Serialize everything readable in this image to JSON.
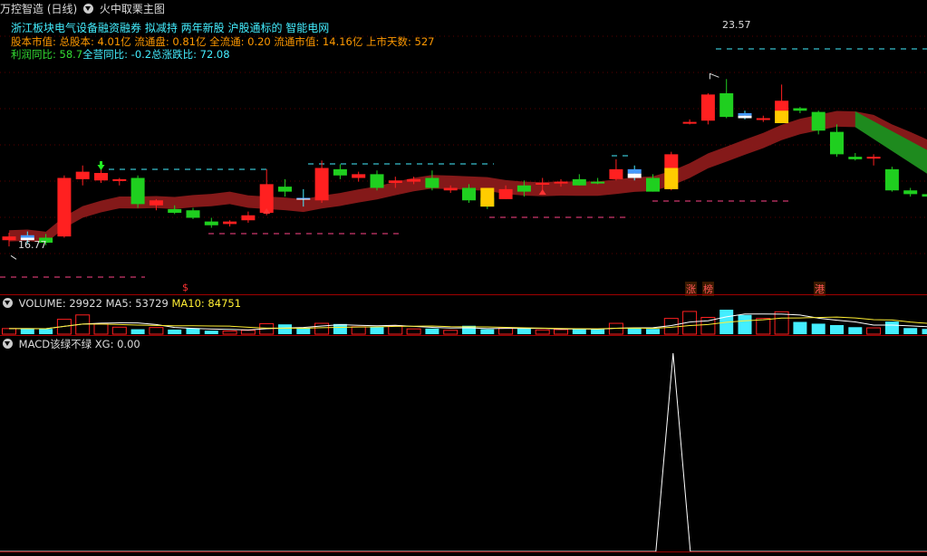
{
  "header": {
    "stock_title": "万控智造 (日线)",
    "main_indicator": "火中取栗主图"
  },
  "info": {
    "line1": "浙江板块电气设备融资融券 拟减持 两年新股 沪股通标的 智能电网",
    "line2": "股本市值: 总股本: 4.01亿 流通盘: 0.81亿 全流通: 0.20 流通市值: 14.16亿 上市天数: 527",
    "line3_a": "利润同比: 58.7",
    "line3_b": "全营同比: -0.2",
    "line3_c": "总涨跌比: 72.08"
  },
  "price_labels": {
    "high": "23.57",
    "low": "16.77"
  },
  "badges": {
    "s": "$",
    "zhang": "涨",
    "bang": "榜",
    "gang": "港"
  },
  "volume_panel": {
    "title": "VOLUME: 29922",
    "ma5": "MA5: 53729",
    "ma10": "MA10: 84751"
  },
  "macd_panel": {
    "title": "MACD该绿不绿",
    "xg": "XG: 0.00"
  },
  "colors": {
    "up": "#ff2020",
    "down": "#22cc22",
    "cyan": "#44eeff",
    "ma_band": "#8b1a1a",
    "ma_band_green": "#1e8a1e",
    "separator": "#a00000"
  },
  "chart_data": {
    "type": "candlestick",
    "price_range": [
      16.2,
      24.2
    ],
    "candles": [
      {
        "o": 17.1,
        "h": 17.4,
        "l": 16.85,
        "c": 17.25,
        "col": "red"
      },
      {
        "o": 17.1,
        "h": 17.45,
        "l": 16.95,
        "c": 17.3,
        "col": "cyan"
      },
      {
        "o": 17.2,
        "h": 17.35,
        "l": 16.9,
        "c": 17.0,
        "col": "green"
      },
      {
        "o": 17.25,
        "h": 19.7,
        "l": 17.2,
        "c": 19.6,
        "col": "red"
      },
      {
        "o": 19.55,
        "h": 20.1,
        "l": 19.3,
        "c": 19.85,
        "col": "red"
      },
      {
        "o": 19.8,
        "h": 20.0,
        "l": 19.4,
        "c": 19.5,
        "col": "red"
      },
      {
        "o": 19.5,
        "h": 19.6,
        "l": 19.3,
        "c": 19.55,
        "col": "red"
      },
      {
        "o": 19.6,
        "h": 19.7,
        "l": 18.4,
        "c": 18.55,
        "col": "green"
      },
      {
        "o": 18.5,
        "h": 18.75,
        "l": 18.3,
        "c": 18.7,
        "col": "red"
      },
      {
        "o": 18.35,
        "h": 18.5,
        "l": 18.15,
        "c": 18.2,
        "col": "green"
      },
      {
        "o": 18.3,
        "h": 18.4,
        "l": 17.95,
        "c": 18.0,
        "col": "green"
      },
      {
        "o": 17.85,
        "h": 18.0,
        "l": 17.6,
        "c": 17.7,
        "col": "green"
      },
      {
        "o": 17.75,
        "h": 17.9,
        "l": 17.65,
        "c": 17.85,
        "col": "red"
      },
      {
        "o": 17.9,
        "h": 18.25,
        "l": 17.8,
        "c": 18.1,
        "col": "red"
      },
      {
        "o": 18.2,
        "h": 19.95,
        "l": 18.1,
        "c": 19.35,
        "col": "red"
      },
      {
        "o": 19.25,
        "h": 19.55,
        "l": 18.85,
        "c": 19.05,
        "col": "green"
      },
      {
        "o": 18.75,
        "h": 19.15,
        "l": 18.45,
        "c": 18.8,
        "col": "cyan"
      },
      {
        "o": 18.7,
        "h": 20.3,
        "l": 18.6,
        "c": 20.0,
        "col": "red"
      },
      {
        "o": 19.95,
        "h": 20.15,
        "l": 19.55,
        "c": 19.7,
        "col": "green"
      },
      {
        "o": 19.75,
        "h": 19.85,
        "l": 19.45,
        "c": 19.6,
        "col": "red"
      },
      {
        "o": 19.75,
        "h": 19.9,
        "l": 19.1,
        "c": 19.2,
        "col": "green"
      },
      {
        "o": 19.5,
        "h": 19.65,
        "l": 19.2,
        "c": 19.4,
        "col": "red"
      },
      {
        "o": 19.55,
        "h": 19.65,
        "l": 19.35,
        "c": 19.45,
        "col": "red"
      },
      {
        "o": 19.6,
        "h": 19.9,
        "l": 19.1,
        "c": 19.2,
        "col": "green"
      },
      {
        "o": 19.2,
        "h": 19.3,
        "l": 19.0,
        "c": 19.1,
        "col": "red"
      },
      {
        "o": 19.2,
        "h": 19.35,
        "l": 18.6,
        "c": 18.7,
        "col": "green"
      },
      {
        "o": 18.8,
        "h": 18.95,
        "l": 18.35,
        "c": 18.45,
        "col": "green"
      },
      {
        "o": 19.15,
        "h": 19.3,
        "l": 18.75,
        "c": 18.75,
        "col": "red"
      },
      {
        "o": 19.3,
        "h": 19.5,
        "l": 18.85,
        "c": 19.05,
        "col": "green"
      },
      {
        "o": 19.4,
        "h": 19.6,
        "l": 19.1,
        "c": 19.35,
        "col": "red"
      },
      {
        "o": 19.4,
        "h": 19.55,
        "l": 19.25,
        "c": 19.45,
        "col": "red"
      },
      {
        "o": 19.55,
        "h": 19.75,
        "l": 19.3,
        "c": 19.3,
        "col": "green"
      },
      {
        "o": 19.45,
        "h": 19.6,
        "l": 19.35,
        "c": 19.45,
        "col": "green"
      },
      {
        "o": 19.55,
        "h": 20.35,
        "l": 19.5,
        "c": 19.95,
        "col": "red"
      },
      {
        "o": 19.6,
        "h": 20.1,
        "l": 19.5,
        "c": 19.95,
        "col": "cyan"
      },
      {
        "o": 19.6,
        "h": 19.75,
        "l": 19.05,
        "c": 19.05,
        "col": "green"
      },
      {
        "o": 19.15,
        "h": 20.65,
        "l": 19.1,
        "c": 20.55,
        "col": "red"
      },
      {
        "o": 21.8,
        "h": 21.95,
        "l": 21.75,
        "c": 21.85,
        "col": "red"
      },
      {
        "o": 21.9,
        "h": 23.0,
        "l": 21.75,
        "c": 22.95,
        "col": "red"
      },
      {
        "o": 23.0,
        "h": 23.57,
        "l": 22.0,
        "c": 22.05,
        "col": "green"
      },
      {
        "o": 22.0,
        "h": 22.3,
        "l": 21.95,
        "c": 22.2,
        "col": "cyan"
      },
      {
        "o": 22.0,
        "h": 22.1,
        "l": 21.85,
        "c": 21.95,
        "col": "red"
      },
      {
        "o": 21.95,
        "h": 23.35,
        "l": 21.8,
        "c": 22.7,
        "col": "red"
      },
      {
        "o": 22.4,
        "h": 22.45,
        "l": 22.2,
        "c": 22.3,
        "col": "green"
      },
      {
        "o": 22.25,
        "h": 22.3,
        "l": 21.35,
        "c": 21.5,
        "col": "green"
      },
      {
        "o": 21.45,
        "h": 21.75,
        "l": 20.45,
        "c": 20.55,
        "col": "green"
      },
      {
        "o": 20.45,
        "h": 20.6,
        "l": 20.3,
        "c": 20.35,
        "col": "green"
      },
      {
        "o": 20.45,
        "h": 20.55,
        "l": 20.1,
        "c": 20.4,
        "col": "red"
      },
      {
        "o": 19.95,
        "h": 20.05,
        "l": 19.05,
        "c": 19.1,
        "col": "green"
      },
      {
        "o": 19.1,
        "h": 19.2,
        "l": 18.85,
        "c": 18.95,
        "col": "green"
      },
      {
        "o": 18.95,
        "h": 19.0,
        "l": 18.8,
        "c": 18.85,
        "col": "green"
      }
    ],
    "volume_range": [
      0,
      140000
    ],
    "volumes": [
      {
        "v": 32000,
        "col": "red"
      },
      {
        "v": 31000,
        "col": "cyan"
      },
      {
        "v": 30000,
        "col": "cyan"
      },
      {
        "v": 85000,
        "col": "red"
      },
      {
        "v": 110000,
        "col": "red"
      },
      {
        "v": 58000,
        "col": "red"
      },
      {
        "v": 40000,
        "col": "red"
      },
      {
        "v": 28000,
        "col": "cyan"
      },
      {
        "v": 38000,
        "col": "red"
      },
      {
        "v": 26000,
        "col": "cyan"
      },
      {
        "v": 34000,
        "col": "cyan"
      },
      {
        "v": 20000,
        "col": "cyan"
      },
      {
        "v": 18000,
        "col": "red"
      },
      {
        "v": 22000,
        "col": "red"
      },
      {
        "v": 60000,
        "col": "red"
      },
      {
        "v": 56000,
        "col": "cyan"
      },
      {
        "v": 34000,
        "col": "cyan"
      },
      {
        "v": 62000,
        "col": "red"
      },
      {
        "v": 58000,
        "col": "cyan"
      },
      {
        "v": 42000,
        "col": "red"
      },
      {
        "v": 44000,
        "col": "cyan"
      },
      {
        "v": 48000,
        "col": "red"
      },
      {
        "v": 30000,
        "col": "red"
      },
      {
        "v": 32000,
        "col": "cyan"
      },
      {
        "v": 22000,
        "col": "red"
      },
      {
        "v": 48000,
        "col": "cyan"
      },
      {
        "v": 28000,
        "col": "cyan"
      },
      {
        "v": 34000,
        "col": "red"
      },
      {
        "v": 34000,
        "col": "cyan"
      },
      {
        "v": 24000,
        "col": "red"
      },
      {
        "v": 26000,
        "col": "red"
      },
      {
        "v": 30000,
        "col": "cyan"
      },
      {
        "v": 28000,
        "col": "cyan"
      },
      {
        "v": 62000,
        "col": "red"
      },
      {
        "v": 36000,
        "col": "cyan"
      },
      {
        "v": 30000,
        "col": "cyan"
      },
      {
        "v": 90000,
        "col": "red"
      },
      {
        "v": 130000,
        "col": "red"
      },
      {
        "v": 96000,
        "col": "red"
      },
      {
        "v": 150000,
        "col": "cyan"
      },
      {
        "v": 110000,
        "col": "cyan"
      },
      {
        "v": 90000,
        "col": "red"
      },
      {
        "v": 128000,
        "col": "red"
      },
      {
        "v": 70000,
        "col": "cyan"
      },
      {
        "v": 60000,
        "col": "cyan"
      },
      {
        "v": 52000,
        "col": "cyan"
      },
      {
        "v": 40000,
        "col": "cyan"
      },
      {
        "v": 36000,
        "col": "red"
      },
      {
        "v": 72000,
        "col": "cyan"
      },
      {
        "v": 35000,
        "col": "cyan"
      },
      {
        "v": 29922,
        "col": "cyan"
      }
    ],
    "macd_xg": {
      "range": [
        0,
        1
      ],
      "spike_index": 36,
      "values": "0 everywhere except 1 at the spike"
    }
  }
}
